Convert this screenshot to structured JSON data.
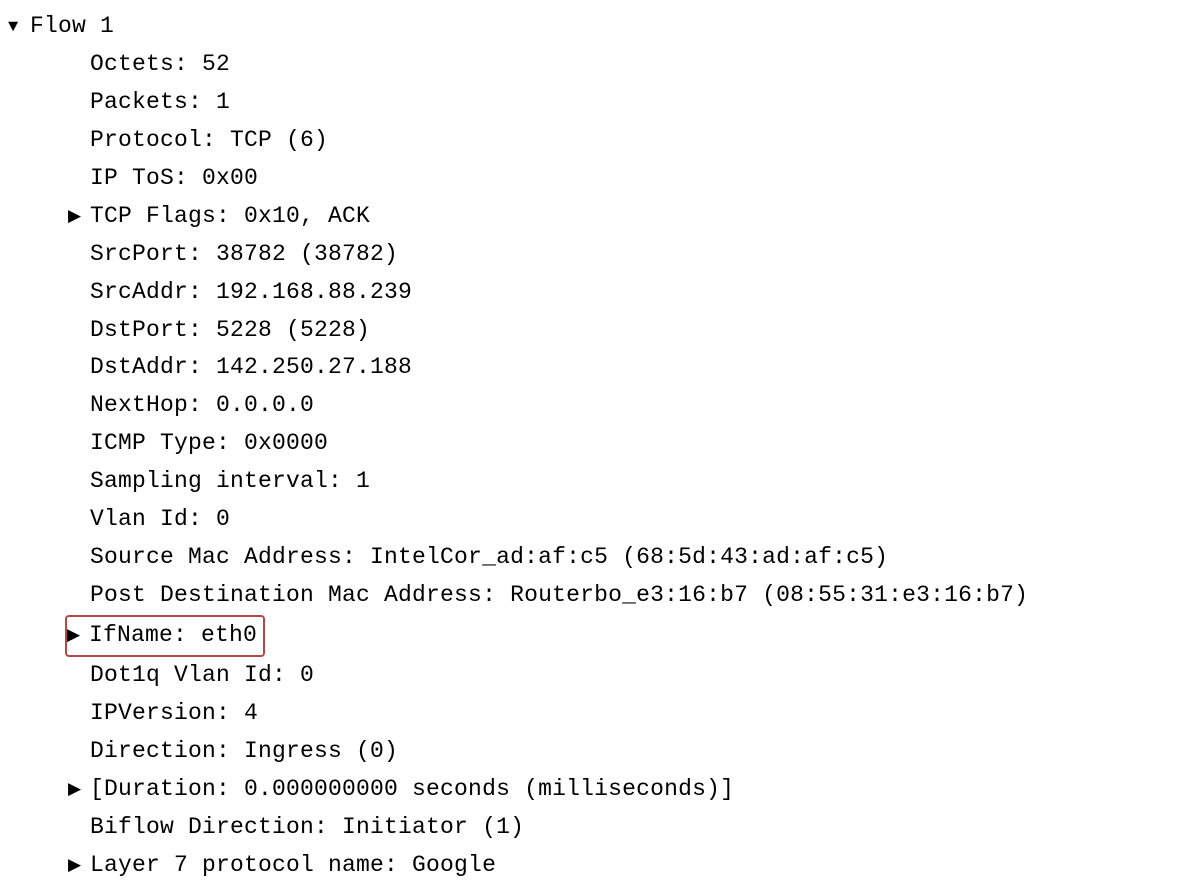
{
  "flow": {
    "title": "Flow 1",
    "fields": [
      {
        "expandable": false,
        "highlighted": false,
        "text": "Octets: 52"
      },
      {
        "expandable": false,
        "highlighted": false,
        "text": "Packets: 1"
      },
      {
        "expandable": false,
        "highlighted": false,
        "text": "Protocol: TCP (6)"
      },
      {
        "expandable": false,
        "highlighted": false,
        "text": "IP ToS: 0x00"
      },
      {
        "expandable": true,
        "highlighted": false,
        "text": "TCP Flags: 0x10, ACK"
      },
      {
        "expandable": false,
        "highlighted": false,
        "text": "SrcPort: 38782 (38782)"
      },
      {
        "expandable": false,
        "highlighted": false,
        "text": "SrcAddr: 192.168.88.239"
      },
      {
        "expandable": false,
        "highlighted": false,
        "text": "DstPort: 5228 (5228)"
      },
      {
        "expandable": false,
        "highlighted": false,
        "text": "DstAddr: 142.250.27.188"
      },
      {
        "expandable": false,
        "highlighted": false,
        "text": "NextHop: 0.0.0.0"
      },
      {
        "expandable": false,
        "highlighted": false,
        "text": "ICMP Type: 0x0000"
      },
      {
        "expandable": false,
        "highlighted": false,
        "text": "Sampling interval: 1"
      },
      {
        "expandable": false,
        "highlighted": false,
        "text": "Vlan Id: 0"
      },
      {
        "expandable": false,
        "highlighted": false,
        "text": "Source Mac Address: IntelCor_ad:af:c5 (68:5d:43:ad:af:c5)"
      },
      {
        "expandable": false,
        "highlighted": false,
        "text": "Post Destination Mac Address: Routerbo_e3:16:b7 (08:55:31:e3:16:b7)"
      },
      {
        "expandable": true,
        "highlighted": true,
        "text": "IfName: eth0"
      },
      {
        "expandable": false,
        "highlighted": false,
        "text": "Dot1q Vlan Id: 0"
      },
      {
        "expandable": false,
        "highlighted": false,
        "text": "IPVersion: 4"
      },
      {
        "expandable": false,
        "highlighted": false,
        "text": "Direction: Ingress (0)"
      },
      {
        "expandable": true,
        "highlighted": false,
        "text": "[Duration: 0.000000000 seconds (milliseconds)]"
      },
      {
        "expandable": false,
        "highlighted": false,
        "text": "Biflow Direction: Initiator (1)"
      },
      {
        "expandable": true,
        "highlighted": false,
        "text": "Layer 7 protocol name: Google"
      }
    ]
  },
  "glyphs": {
    "expanded": "▼",
    "collapsed": "▶"
  }
}
